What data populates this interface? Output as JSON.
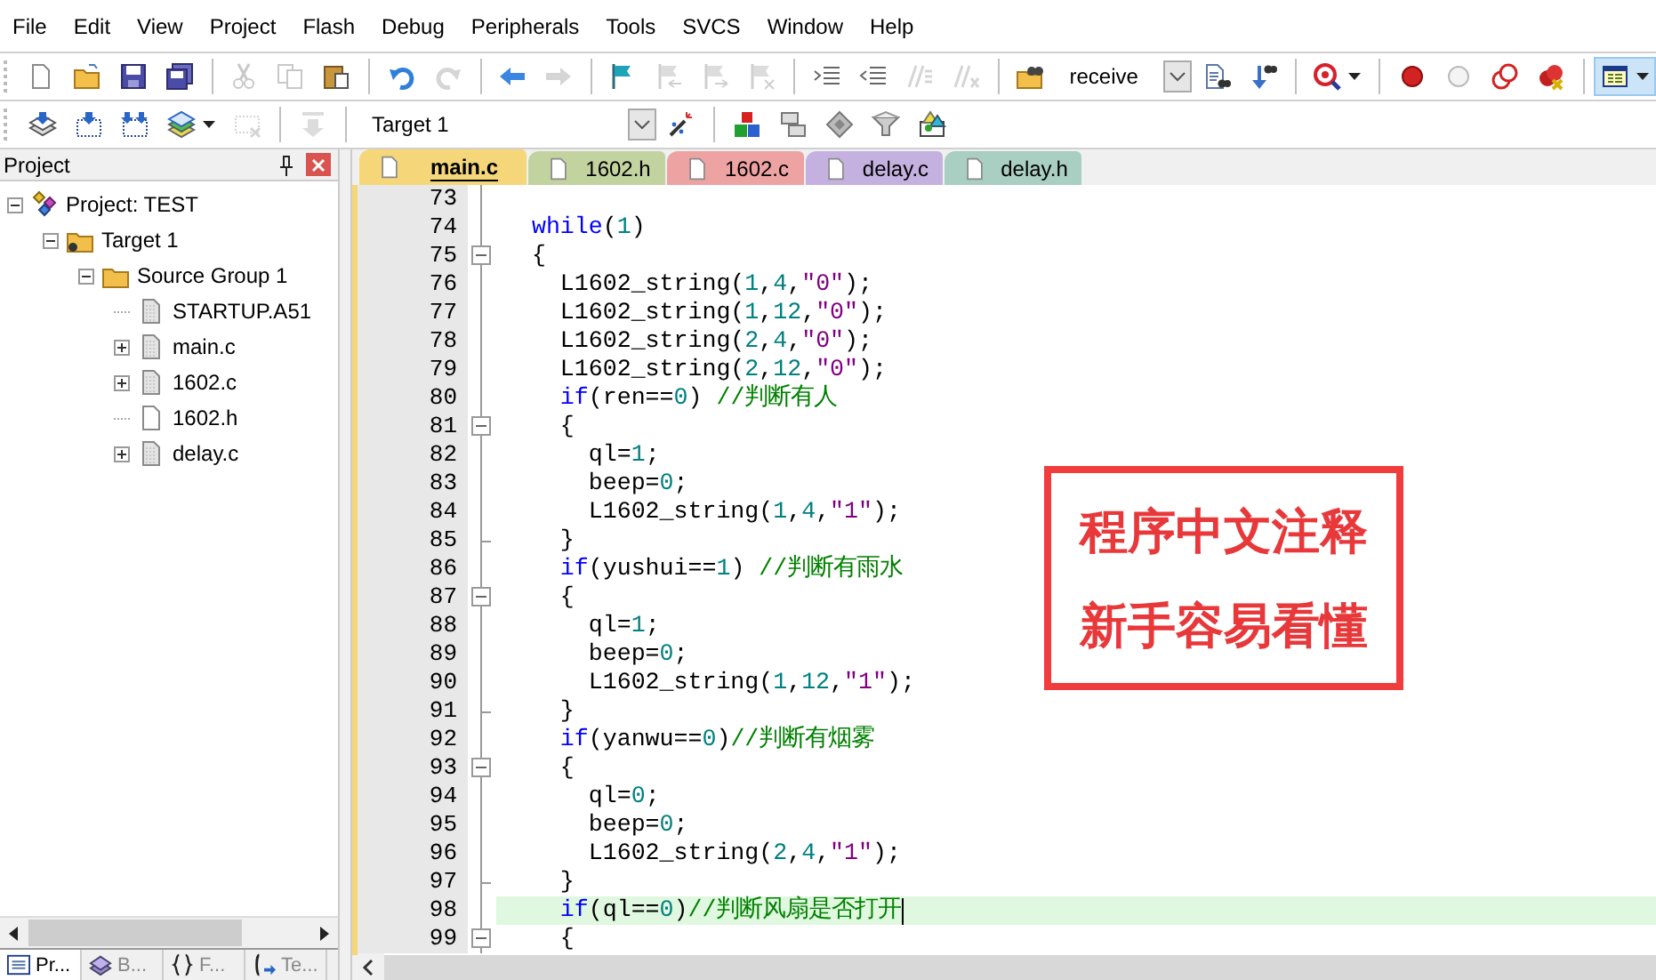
{
  "menu": [
    "File",
    "Edit",
    "View",
    "Project",
    "Flash",
    "Debug",
    "Peripherals",
    "Tools",
    "SVCS",
    "Window",
    "Help"
  ],
  "toolbar_1": [
    {
      "kind": "button",
      "disabled": false
    },
    {
      "kind": "button",
      "disabled": false
    },
    {
      "kind": "button",
      "disabled": false
    },
    {
      "kind": "button",
      "disabled": false
    },
    {
      "kind": "separator"
    },
    {
      "kind": "button",
      "disabled": true
    },
    {
      "kind": "button",
      "disabled": true
    },
    {
      "kind": "button",
      "disabled": false
    },
    {
      "kind": "separator"
    },
    {
      "kind": "button",
      "disabled": false
    },
    {
      "kind": "button",
      "disabled": true
    },
    {
      "kind": "separator"
    },
    {
      "kind": "button",
      "disabled": false
    },
    {
      "kind": "button",
      "disabled": true
    },
    {
      "kind": "separator"
    },
    {
      "kind": "button",
      "disabled": false
    },
    {
      "kind": "button",
      "disabled": true
    },
    {
      "kind": "button",
      "disabled": true
    },
    {
      "kind": "button",
      "disabled": true
    },
    {
      "kind": "separator"
    },
    {
      "kind": "button",
      "disabled": false
    },
    {
      "kind": "button",
      "disabled": false
    },
    {
      "kind": "button",
      "disabled": true
    },
    {
      "kind": "button",
      "disabled": true
    },
    {
      "kind": "separator"
    },
    {
      "kind": "button",
      "disabled": false
    },
    {
      "kind": "combo",
      "value": "receive"
    },
    {
      "kind": "button",
      "disabled": false
    },
    {
      "kind": "button",
      "disabled": false
    },
    {
      "kind": "separator"
    },
    {
      "kind": "menu-button",
      "disabled": false
    },
    {
      "kind": "separator"
    },
    {
      "kind": "button",
      "disabled": false
    },
    {
      "kind": "button",
      "disabled": false
    },
    {
      "kind": "button",
      "disabled": false
    },
    {
      "kind": "button",
      "disabled": false
    },
    {
      "kind": "separator"
    },
    {
      "kind": "toggle",
      "on": true
    }
  ],
  "toolbar_2": [
    {
      "kind": "button",
      "disabled": false
    },
    {
      "kind": "button",
      "disabled": false
    },
    {
      "kind": "button",
      "disabled": false
    },
    {
      "kind": "menu-button",
      "disabled": false
    },
    {
      "kind": "button",
      "disabled": true
    },
    {
      "kind": "separator"
    },
    {
      "kind": "button",
      "disabled": true
    },
    {
      "kind": "separator"
    },
    {
      "kind": "combo",
      "value": "Target 1"
    },
    {
      "kind": "button",
      "disabled": false
    },
    {
      "kind": "separator"
    },
    {
      "kind": "button",
      "disabled": false
    },
    {
      "kind": "button",
      "disabled": false
    },
    {
      "kind": "button",
      "disabled": false
    },
    {
      "kind": "button",
      "disabled": false
    },
    {
      "kind": "button",
      "disabled": false
    }
  ],
  "project_panel": {
    "title": "Project",
    "tree": [
      {
        "label": "Project: TEST",
        "kind": "project",
        "expanded": true,
        "children": [
          {
            "label": "Target 1",
            "kind": "target",
            "expanded": true,
            "children": [
              {
                "label": "Source Group 1",
                "kind": "group",
                "expanded": true,
                "children": [
                  {
                    "label": "STARTUP.A51",
                    "kind": "source"
                  },
                  {
                    "label": "main.c",
                    "kind": "source",
                    "expanded": false
                  },
                  {
                    "label": "1602.c",
                    "kind": "source",
                    "expanded": false
                  },
                  {
                    "label": "1602.h",
                    "kind": "header"
                  },
                  {
                    "label": "delay.c",
                    "kind": "source",
                    "expanded": false
                  }
                ]
              }
            ]
          }
        ]
      }
    ],
    "bottom_tabs": [
      {
        "label": "Pr...",
        "selected": true
      },
      {
        "label": "B...",
        "selected": false
      },
      {
        "label": "F...",
        "selected": false
      },
      {
        "label": "Te...",
        "selected": false
      }
    ]
  },
  "editor_tabs": [
    {
      "label": "main.c",
      "color": "#f5d77a",
      "selected": true
    },
    {
      "label": "1602.h",
      "color": "#c3d3a0",
      "selected": false
    },
    {
      "label": "1602.c",
      "color": "#eea3a3",
      "selected": false
    },
    {
      "label": "delay.c",
      "color": "#c5b1e0",
      "selected": false
    },
    {
      "label": "delay.h",
      "color": "#a9cfc3",
      "selected": false
    }
  ],
  "lines": [
    {
      "number": "73",
      "fold_start": false,
      "fold_end": false,
      "current": false
    },
    {
      "number": "74",
      "fold_start": false,
      "fold_end": false,
      "current": false,
      "text": "  while(1)"
    },
    {
      "number": "75",
      "fold_start": true,
      "fold_end": false,
      "current": false,
      "text": "  {"
    },
    {
      "number": "76",
      "fold_start": false,
      "fold_end": false,
      "current": false,
      "text": "    L1602_string(1,4,\"0\");"
    },
    {
      "number": "77",
      "fold_start": false,
      "fold_end": false,
      "current": false,
      "text": "    L1602_string(1,12,\"0\");"
    },
    {
      "number": "78",
      "fold_start": false,
      "fold_end": false,
      "current": false,
      "text": "    L1602_string(2,4,\"0\");"
    },
    {
      "number": "79",
      "fold_start": false,
      "fold_end": false,
      "current": false,
      "text": "    L1602_string(2,12,\"0\");"
    },
    {
      "number": "80",
      "fold_start": false,
      "fold_end": false,
      "current": false,
      "text": "    if(ren==0) //判断有人"
    },
    {
      "number": "81",
      "fold_start": true,
      "fold_end": false,
      "current": false,
      "text": "    {"
    },
    {
      "number": "82",
      "fold_start": false,
      "fold_end": false,
      "current": false,
      "text": "      ql=1;"
    },
    {
      "number": "83",
      "fold_start": false,
      "fold_end": false,
      "current": false,
      "text": "      beep=0;"
    },
    {
      "number": "84",
      "fold_start": false,
      "fold_end": false,
      "current": false,
      "text": "      L1602_string(1,4,\"1\");"
    },
    {
      "number": "85",
      "fold_start": false,
      "fold_end": true,
      "current": false,
      "text": "    }"
    },
    {
      "number": "86",
      "fold_start": false,
      "fold_end": false,
      "current": false,
      "text": "    if(yushui==1) //判断有雨水"
    },
    {
      "number": "87",
      "fold_start": true,
      "fold_end": false,
      "current": false,
      "text": "    {"
    },
    {
      "number": "88",
      "fold_start": false,
      "fold_end": false,
      "current": false,
      "text": "      ql=1;"
    },
    {
      "number": "89",
      "fold_start": false,
      "fold_end": false,
      "current": false,
      "text": "      beep=0;"
    },
    {
      "number": "90",
      "fold_start": false,
      "fold_end": false,
      "current": false,
      "text": "      L1602_string(1,12,\"1\");"
    },
    {
      "number": "91",
      "fold_start": false,
      "fold_end": true,
      "current": false,
      "text": "    }"
    },
    {
      "number": "92",
      "fold_start": false,
      "fold_end": false,
      "current": false,
      "text": "    if(yanwu==0)//判断有烟雾"
    },
    {
      "number": "93",
      "fold_start": true,
      "fold_end": false,
      "current": false,
      "text": "    {"
    },
    {
      "number": "94",
      "fold_start": false,
      "fold_end": false,
      "current": false,
      "text": "      ql=0;"
    },
    {
      "number": "95",
      "fold_start": false,
      "fold_end": false,
      "current": false,
      "text": "      beep=0;"
    },
    {
      "number": "96",
      "fold_start": false,
      "fold_end": false,
      "current": false,
      "text": "      L1602_string(2,4,\"1\");"
    },
    {
      "number": "97",
      "fold_start": false,
      "fold_end": true,
      "current": false,
      "text": "    }"
    },
    {
      "number": "98",
      "fold_start": false,
      "fold_end": false,
      "current": true,
      "text": "    if(ql==0)//判断风扇是否打开"
    },
    {
      "number": "99",
      "fold_start": true,
      "fold_end": false,
      "current": false,
      "text": "    {"
    }
  ],
  "annotation": {
    "lines": [
      "程序中文注释",
      "新手容易看懂"
    ]
  }
}
